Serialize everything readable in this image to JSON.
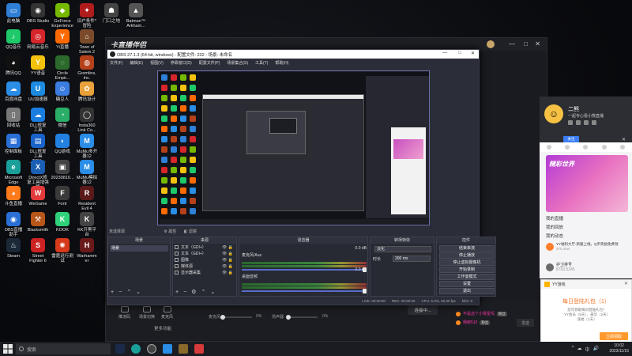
{
  "desktop_icons": [
    {
      "label": "此电脑",
      "color": "#2f7fd6",
      "glyph": "▭"
    },
    {
      "label": "OBS Studio",
      "color": "#333333",
      "glyph": "◉"
    },
    {
      "label": "GeForce\nExperience",
      "color": "#76b900",
      "glyph": "◆"
    },
    {
      "label": "旧户条件*\n冒险",
      "color": "#b01c1c",
      "glyph": "✦"
    },
    {
      "label": "门口之地",
      "color": "#444444",
      "glyph": "☗"
    },
    {
      "label": "Batman™\nArkham...",
      "color": "#555555",
      "glyph": "▲"
    },
    {
      "label": "QQ音乐",
      "color": "#1ec96a",
      "glyph": "♪"
    },
    {
      "label": "网易云音乐",
      "color": "#d6252b",
      "glyph": "◎"
    },
    {
      "label": "Yi直播",
      "color": "#ff6a00",
      "glyph": "Y"
    },
    {
      "label": "Town of\nSalem 2",
      "color": "#7a4a2a",
      "glyph": "⌂"
    },
    {
      "label": "腾讯QQ",
      "color": "#111111",
      "glyph": "◕"
    },
    {
      "label": "YY语音",
      "color": "#f4c20d",
      "glyph": "Y"
    },
    {
      "label": "Circle\nEmpir...",
      "color": "#2b6a2b",
      "glyph": "◌"
    },
    {
      "label": "Gremlins,\nInc.",
      "color": "#b5411a",
      "glyph": "◍"
    },
    {
      "label": "百度网盘",
      "color": "#2a8de6",
      "glyph": "☁"
    },
    {
      "label": "UU加速器",
      "color": "#1c8be0",
      "glyph": "U"
    },
    {
      "label": "糖豆人",
      "color": "#3b7de0",
      "glyph": "☺"
    },
    {
      "label": "腾讯设计",
      "color": "#e8a13b",
      "glyph": "✿"
    },
    {
      "label": "回收站",
      "color": "#777777",
      "glyph": "▯"
    },
    {
      "label": "DLL修复\n工具",
      "color": "#1a7de0",
      "glyph": "☁"
    },
    {
      "label": "微信",
      "color": "#2aae67",
      "glyph": "◔"
    },
    {
      "label": "Insta360\nLink Co...",
      "color": "#333333",
      "glyph": "◯"
    },
    {
      "label": "控制面板",
      "color": "#2a6fd6",
      "glyph": "▦"
    },
    {
      "label": "DLL修复\n工具_TIFIL...",
      "color": "#1a63c9",
      "glyph": "▤"
    },
    {
      "label": "QQ游戏",
      "color": "#2280e0",
      "glyph": "◗"
    },
    {
      "label": "MuMu多开\n器12",
      "color": "#2a8de6",
      "glyph": "M"
    },
    {
      "label": "Microsoft\nEdge",
      "color": "#1b9f9a",
      "glyph": "e"
    },
    {
      "label": "DirectX修\n复工具增强版",
      "color": "#1a5fb4",
      "glyph": "X"
    },
    {
      "label": "20230810...",
      "color": "#444444",
      "glyph": "▣"
    },
    {
      "label": "MuMu模拟\n器12",
      "color": "#2a8de6",
      "glyph": "M"
    },
    {
      "label": "斗鱼直播",
      "color": "#ff7a1a",
      "glyph": "◕"
    },
    {
      "label": "WeGame",
      "color": "#e23a3a",
      "glyph": "W"
    },
    {
      "label": "Fortr",
      "color": "#3a3a3a",
      "glyph": "F"
    },
    {
      "label": "Resident\nEvil 4",
      "color": "#5a1a1a",
      "glyph": "R"
    },
    {
      "label": "OBS直播\n助手",
      "color": "#2a6fd6",
      "glyph": "◉"
    },
    {
      "label": "Blacksmith",
      "color": "#b8561a",
      "glyph": "⚒"
    },
    {
      "label": "KOOK",
      "color": "#2fd27a",
      "glyph": "K"
    },
    {
      "label": "KK开黑平\n台",
      "color": "#444444",
      "glyph": "K"
    },
    {
      "label": "Steam",
      "color": "#1b2838",
      "glyph": "♨"
    },
    {
      "label": "Street\nFighter 6",
      "color": "#c22",
      "glyph": "S"
    },
    {
      "label": "雷霆运行测试",
      "color": "#d63a1a",
      "glyph": "✺"
    },
    {
      "label": "Warhamm\ner",
      "color": "#6a1a1a",
      "glyph": "H"
    }
  ],
  "live_app": {
    "logo": "卡直播伴侣",
    "controls": [
      "推流码",
      "场景切换",
      "麦克风"
    ],
    "mic_label": "麦克风",
    "mic_pct": "0%",
    "speaker_label": "扬声器",
    "speaker_pct": "0%",
    "connect_button": "连接中...",
    "feature_button": "更多功能",
    "chat": [
      {
        "text": "不是这个小零星吗",
        "badge": "粉丝"
      },
      {
        "text": "杨柳510",
        "badge": "粉丝"
      }
    ],
    "send_button": "发送"
  },
  "right_panel": {
    "name": "二熊",
    "sub": "一起专心看小熊直播",
    "follow_button": "关注",
    "banner_title": "精彩世界",
    "items": [
      "我的直播",
      "我的回放",
      "我的动态"
    ],
    "fan_msg": "YY福利大厅·新版上线，Q币奖励免费领",
    "fan_sub": "375.45w",
    "guard_title": "护卫排号",
    "guard_sub": "8783.5345"
  },
  "popup": {
    "app": "YY游戏",
    "title": "每日登陆礼包（1）",
    "body": "您可领取每日登陆礼包！\nYY会员（5天）、豪华（2天）\n涨福（1天）",
    "button": "立即领取"
  },
  "obs": {
    "title": "OBS 27.1.3 (64-bit, windows) - 配置文件: 232 - 场景: 未命名",
    "menu": [
      "文件(F)",
      "编辑(E)",
      "视图(V)",
      "停靠窗口(D)",
      "配置文件(P)",
      "场景集合(S)",
      "工具(T)",
      "帮助(H)"
    ],
    "status_left": "未选择源",
    "status_left_btns": [
      "属性",
      "滤镜"
    ],
    "docks": {
      "scenes": {
        "title": "场景",
        "items": [
          "场景"
        ]
      },
      "sources": {
        "title": "来源",
        "items": [
          {
            "name": "文本（GDI+）"
          },
          {
            "name": "文本（GDI+）"
          },
          {
            "name": "图像"
          },
          {
            "name": "媒体源"
          },
          {
            "name": "显示器采集"
          }
        ]
      },
      "mixer": {
        "title": "混音器",
        "channels": [
          {
            "name": "麦克风/Aux",
            "db": "0.0 dB"
          },
          {
            "name": "桌面音频",
            "db": "0.0 dB"
          }
        ]
      },
      "transitions": {
        "title": "转场特效",
        "effect": "淡化",
        "duration_label": "时长",
        "duration": "300 ms"
      },
      "controls": {
        "title": "控件",
        "buttons": [
          "结束串流",
          "停止播放",
          "停止虚拟摄像机",
          "开始录制",
          "工作室模式",
          "设置",
          "退出"
        ]
      }
    },
    "statusbar": [
      "LIVE: 00:00:00",
      "REC: 00:00:00",
      "CPU: 5.0%, 60.00 fps",
      "kb/s: 0"
    ]
  },
  "taskbar": {
    "search_placeholder": "搜索",
    "time": "10:02",
    "date": "2023/11/16",
    "tray": [
      "^",
      "☁",
      "中",
      "🔊"
    ]
  }
}
